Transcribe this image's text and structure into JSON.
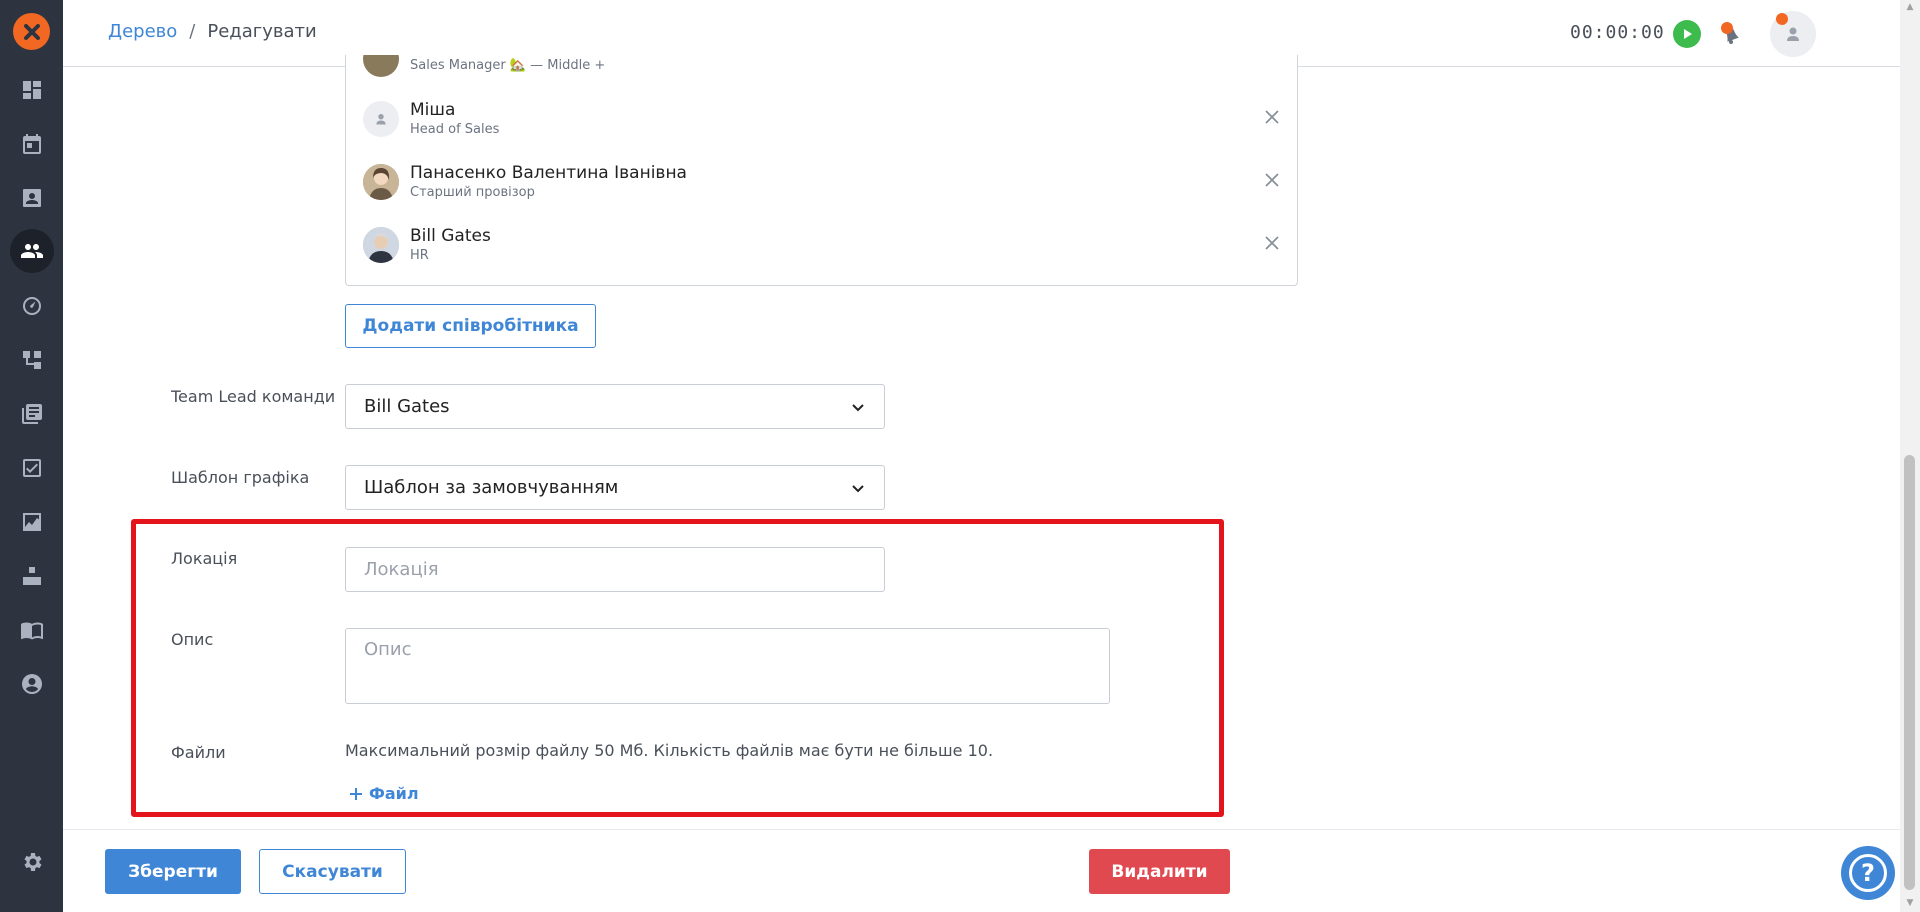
{
  "header": {
    "breadcrumb_root": "Дерево",
    "breadcrumb_sep": "/",
    "breadcrumb_current": "Редагувати",
    "timer": "00:00:00"
  },
  "sidebar": {
    "items": [
      {
        "icon": "dashboard-icon"
      },
      {
        "icon": "calendar-icon"
      },
      {
        "icon": "contact-card-icon"
      },
      {
        "icon": "team-icon",
        "active": true
      },
      {
        "icon": "speedometer-icon"
      },
      {
        "icon": "org-tree-icon"
      },
      {
        "icon": "library-icon"
      },
      {
        "icon": "task-check-icon"
      },
      {
        "icon": "analytics-icon"
      },
      {
        "icon": "boxes-icon"
      },
      {
        "icon": "book-icon"
      },
      {
        "icon": "user-circle-icon"
      }
    ],
    "settings_icon": "gear-icon"
  },
  "employees": {
    "partial_role": "Sales Manager 🏡 — Middle +",
    "items": [
      {
        "name": "Міша",
        "role": "Head of Sales",
        "avatar": "placeholder"
      },
      {
        "name": "Панасенко Валентина Іванівна",
        "role": "Старший провізор",
        "avatar": "photo"
      },
      {
        "name": "Bill Gates",
        "role": "HR",
        "avatar": "photo"
      }
    ],
    "add_button": "Додати співробітника"
  },
  "form": {
    "team_lead_label": "Team Lead команди",
    "team_lead_value": "Bill Gates",
    "schedule_label": "Шаблон графіка",
    "schedule_value": "Шаблон за замовчуванням",
    "location_label": "Локація",
    "location_placeholder": "Локація",
    "description_label": "Опис",
    "description_placeholder": "Опис",
    "files_label": "Файли",
    "files_hint": "Максимальний розмір файлу 50 Мб. Кількість файлів має бути не більше 10.",
    "add_file": "Файл"
  },
  "footer": {
    "save": "Зберегти",
    "cancel": "Скасувати",
    "delete": "Видалити",
    "help": "?"
  },
  "colors": {
    "accent": "#3f86d6",
    "danger": "#e0494f",
    "highlight": "#e3141b",
    "sidebar": "#2d3440",
    "logo": "#f26722",
    "play": "#3dbb4c"
  }
}
